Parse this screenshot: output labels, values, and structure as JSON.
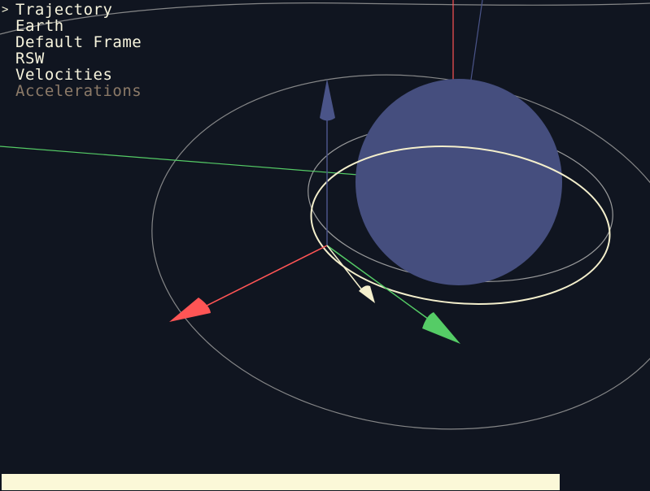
{
  "menu": {
    "items": [
      {
        "label": "Trajectory",
        "selected": true,
        "dimmed": false
      },
      {
        "label": "Earth",
        "selected": false,
        "dimmed": false
      },
      {
        "label": "Default Frame",
        "selected": false,
        "dimmed": false
      },
      {
        "label": "RSW",
        "selected": false,
        "dimmed": false
      },
      {
        "label": "Velocities",
        "selected": false,
        "dimmed": false
      },
      {
        "label": "Accelerations",
        "selected": false,
        "dimmed": true
      }
    ],
    "selection_marker": ">"
  },
  "progress": {
    "fraction": 1.0
  },
  "colors": {
    "background": "#101520",
    "menu_text": "#f7f4dd",
    "menu_text_dim": "#8c7a68",
    "earth": "#454e7e",
    "orbit_grey": "#9a9a9a",
    "trajectory": "#f4efcc",
    "axis_red": "#ff5555",
    "axis_green": "#55cc66",
    "axis_blue": "#4a5488",
    "progress_fill": "#fbf8d8"
  }
}
